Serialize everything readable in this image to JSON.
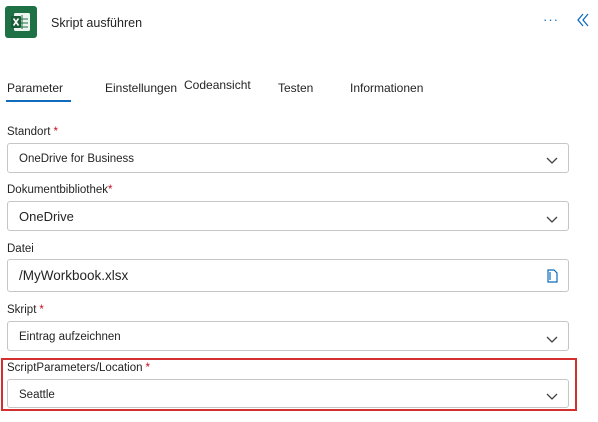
{
  "header": {
    "title": "Skript ausführen",
    "more_label": "···",
    "app_icon": "excel-icon",
    "accent": "#1e7145"
  },
  "tabs": [
    {
      "label": "Parameter",
      "active": true
    },
    {
      "label": "Einstellungen",
      "active": false
    },
    {
      "label": "Codeansicht",
      "active": false
    },
    {
      "label": "Testen",
      "active": false
    },
    {
      "label": "Informationen",
      "active": false
    }
  ],
  "fields": {
    "standort": {
      "label": "Standort",
      "required": "*",
      "value": "OneDrive for Business"
    },
    "bibliothek": {
      "label": "Dokumentbibliothek",
      "required": "*",
      "value": "OneDrive"
    },
    "datei": {
      "label": "Datei",
      "required": "",
      "value": "/MyWorkbook.xlsx"
    },
    "skript": {
      "label": "Skript",
      "required": "*",
      "value": "Eintrag aufzeichnen"
    },
    "location": {
      "label": "ScriptParameters/Location",
      "required": "*",
      "value": "Seattle"
    }
  },
  "colors": {
    "required": "#c50f1f",
    "link": "#0f6cbd",
    "highlight": "#d32f2f"
  }
}
